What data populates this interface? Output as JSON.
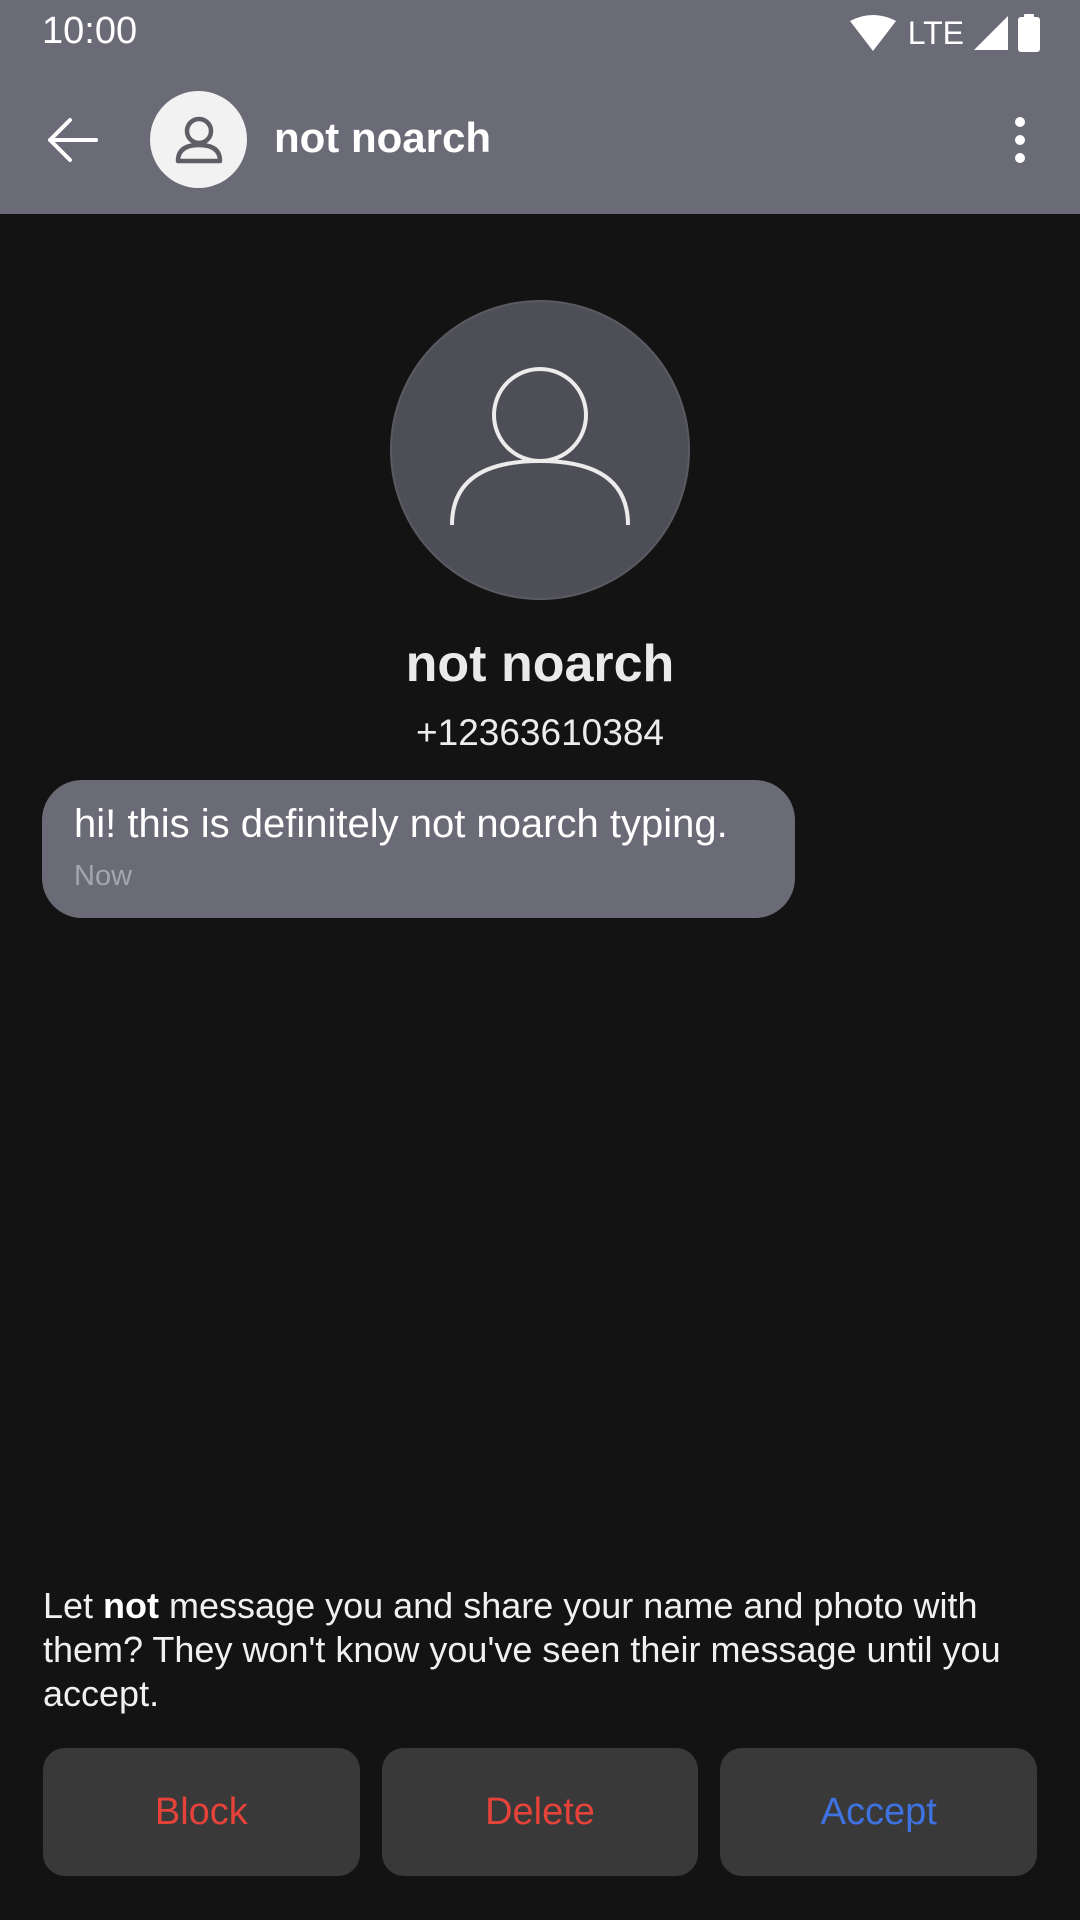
{
  "status_bar": {
    "time": "10:00",
    "network": "LTE",
    "icons": [
      "wifi-icon",
      "cell-signal-icon",
      "battery-icon"
    ]
  },
  "app_bar": {
    "title": "not noarch",
    "icons": [
      "back-arrow-icon",
      "person-icon",
      "more-vert-icon"
    ]
  },
  "profile": {
    "name": "not noarch",
    "phone": "+12363610384"
  },
  "messages": [
    {
      "text": "hi! this is definitely not noarch typing.",
      "time": "Now"
    }
  ],
  "request": {
    "prefix": "Let ",
    "name_bold": "not",
    "suffix": " message you and share your name and photo with them? They won't know you've seen their message until you accept."
  },
  "actions": {
    "block_label": "Block",
    "delete_label": "Delete",
    "accept_label": "Accept"
  },
  "colors": {
    "background": "#131313",
    "bar": "#6b6b78",
    "bubble": "#6b6b78",
    "button_bg": "#393939",
    "destructive": "#e5423a",
    "accept": "#3d72e0"
  }
}
